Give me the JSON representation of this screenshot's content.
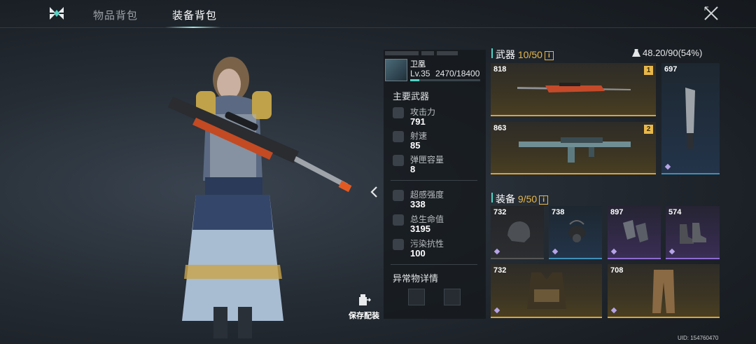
{
  "tabs": [
    {
      "label": "物品背包"
    },
    {
      "label": "装备背包"
    }
  ],
  "player": {
    "name": "卫凰",
    "level": "Lv.35",
    "exp": "2470/18400",
    "exp_fraction": 0.134
  },
  "main_weapon": {
    "title": "主要武器",
    "stats": [
      {
        "label": "攻击力",
        "value": "791",
        "icon": "crosshair-icon"
      },
      {
        "label": "射速",
        "value": "85",
        "icon": "speed-icon"
      },
      {
        "label": "弹匣容量",
        "value": "8",
        "icon": "magazine-icon"
      }
    ]
  },
  "body_stats": [
    {
      "label": "超感强度",
      "value": "338",
      "icon": "psi-icon"
    },
    {
      "label": "总生命值",
      "value": "3195",
      "icon": "heart-icon"
    },
    {
      "label": "污染抗性",
      "value": "100",
      "icon": "radiation-icon"
    }
  ],
  "anomaly": {
    "title": "异常物详情"
  },
  "save_label": "保存配装",
  "weapons_panel": {
    "title": "武器",
    "count": "10/50",
    "info": "i",
    "weight": "48.20/90(54%)"
  },
  "weapons": [
    {
      "power": "818",
      "slot": "1",
      "icon": "sniper-rifle-icon"
    },
    {
      "power": "697",
      "icon": "machete-icon"
    },
    {
      "power": "863",
      "slot": "2",
      "icon": "assault-rifle-icon"
    }
  ],
  "gear_panel": {
    "title": "装备",
    "count": "9/50",
    "info": "i"
  },
  "gear": [
    {
      "power": "732",
      "icon": "helmet-icon"
    },
    {
      "power": "738",
      "icon": "gas-mask-icon"
    },
    {
      "power": "897",
      "icon": "gloves-icon"
    },
    {
      "power": "574",
      "icon": "boots-icon"
    },
    {
      "power": "732",
      "icon": "vest-icon"
    },
    {
      "power": "708",
      "icon": "pants-icon"
    }
  ],
  "uid": "UID: 154760470"
}
